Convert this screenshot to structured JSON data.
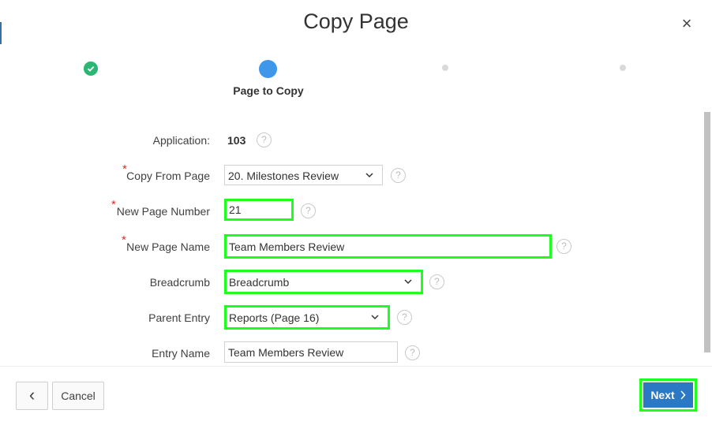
{
  "dialog": {
    "title": "Copy Page",
    "close_label": "×"
  },
  "wizard": {
    "current_step_label": "Page to Copy",
    "colors": {
      "done": "#2bb673",
      "current": "#3e97e8",
      "future": "#d9d9d9"
    }
  },
  "form": {
    "application": {
      "label": "Application:",
      "value": "103"
    },
    "copy_from_page": {
      "label": "Copy From Page",
      "value": "20. Milestones Review"
    },
    "new_page_number": {
      "label": "New Page Number",
      "value": "21"
    },
    "new_page_name": {
      "label": "New Page Name",
      "value": "Team Members Review"
    },
    "breadcrumb": {
      "label": "Breadcrumb",
      "value": "Breadcrumb"
    },
    "parent_entry": {
      "label": "Parent Entry",
      "value": "Reports (Page 16)"
    },
    "entry_name": {
      "label": "Entry Name",
      "value": "Team Members Review"
    },
    "required_marker": "*",
    "help_glyph": "?"
  },
  "footer": {
    "back_glyph": "‹",
    "cancel_label": "Cancel",
    "next_label": "Next"
  },
  "colors": {
    "highlight": "#1fff1f",
    "primary": "#2b78c5",
    "required": "#e0292b"
  }
}
